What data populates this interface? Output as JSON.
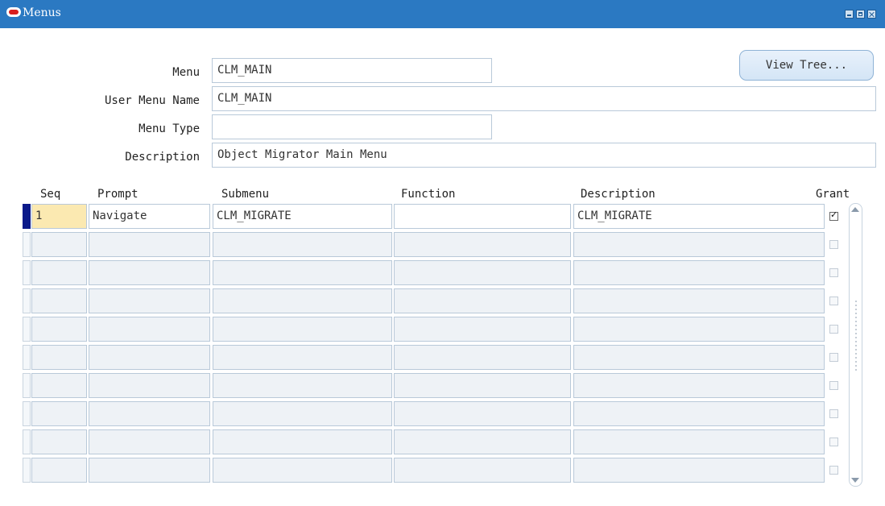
{
  "window": {
    "title": "Menus"
  },
  "header_fields": {
    "menu": {
      "label": "Menu",
      "value": "CLM_MAIN"
    },
    "user_menu_name": {
      "label": "User Menu Name",
      "value": "CLM_MAIN"
    },
    "menu_type": {
      "label": "Menu Type",
      "value": ""
    },
    "description": {
      "label": "Description",
      "value": "Object Migrator Main Menu"
    }
  },
  "buttons": {
    "view_tree": "View Tree..."
  },
  "table": {
    "columns": {
      "seq": "Seq",
      "prompt": "Prompt",
      "submenu": "Submenu",
      "function": "Function",
      "description": "Description",
      "grant": "Grant"
    },
    "rows": [
      {
        "seq": "1",
        "prompt": "Navigate",
        "submenu": "CLM_MIGRATE",
        "function": "",
        "description": "CLM_MIGRATE",
        "grant": true
      },
      {
        "seq": "",
        "prompt": "",
        "submenu": "",
        "function": "",
        "description": "",
        "grant": false
      },
      {
        "seq": "",
        "prompt": "",
        "submenu": "",
        "function": "",
        "description": "",
        "grant": false
      },
      {
        "seq": "",
        "prompt": "",
        "submenu": "",
        "function": "",
        "description": "",
        "grant": false
      },
      {
        "seq": "",
        "prompt": "",
        "submenu": "",
        "function": "",
        "description": "",
        "grant": false
      },
      {
        "seq": "",
        "prompt": "",
        "submenu": "",
        "function": "",
        "description": "",
        "grant": false
      },
      {
        "seq": "",
        "prompt": "",
        "submenu": "",
        "function": "",
        "description": "",
        "grant": false
      },
      {
        "seq": "",
        "prompt": "",
        "submenu": "",
        "function": "",
        "description": "",
        "grant": false
      },
      {
        "seq": "",
        "prompt": "",
        "submenu": "",
        "function": "",
        "description": "",
        "grant": false
      },
      {
        "seq": "",
        "prompt": "",
        "submenu": "",
        "function": "",
        "description": "",
        "grant": false
      }
    ]
  },
  "colors": {
    "titlebar": "#2b79c2",
    "current_record_indicator": "#0b1a8a",
    "current_field_highlight": "#fbe9b1"
  }
}
